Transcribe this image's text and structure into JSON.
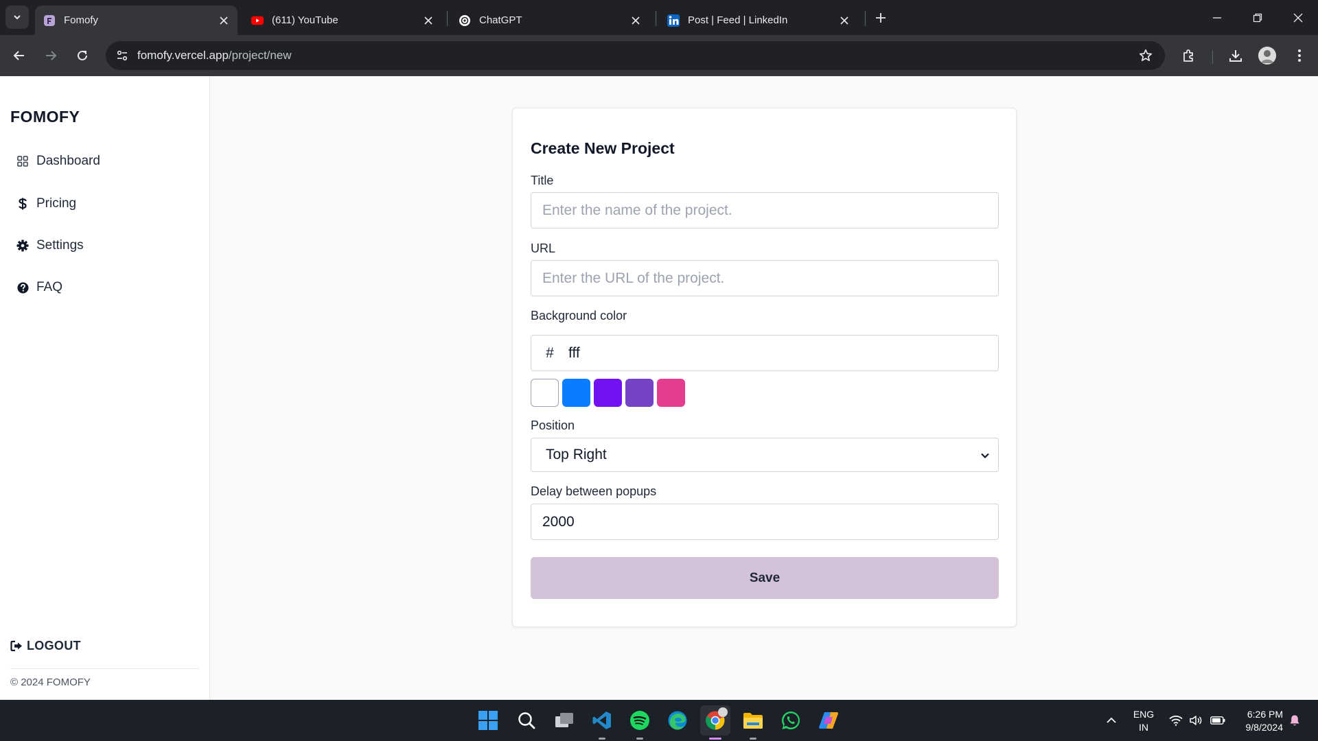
{
  "browser": {
    "tabs": [
      {
        "title": "Fomofy",
        "active": true
      },
      {
        "title": "(611) YouTube",
        "active": false
      },
      {
        "title": "ChatGPT",
        "active": false
      },
      {
        "title": "Post | Feed | LinkedIn",
        "active": false
      }
    ],
    "url_host": "fomofy.vercel.app",
    "url_path": "/project/new"
  },
  "sidebar": {
    "logo": "FOMOFY",
    "items": [
      {
        "label": "Dashboard",
        "icon": "grid-icon"
      },
      {
        "label": "Pricing",
        "icon": "dollar-icon"
      },
      {
        "label": "Settings",
        "icon": "gear-icon"
      },
      {
        "label": "FAQ",
        "icon": "question-circle-icon"
      }
    ],
    "logout": "LOGOUT",
    "copyright": "© 2024 FOMOFY"
  },
  "form": {
    "heading": "Create New Project",
    "title_label": "Title",
    "title_placeholder": "Enter the name of the project.",
    "url_label": "URL",
    "url_placeholder": "Enter the URL of the project.",
    "bg_label": "Background color",
    "hash": "#",
    "bg_value": "fff",
    "swatches": [
      "#ffffff",
      "#0a7cff",
      "#7312f0",
      "#7443c6",
      "#e63e8f"
    ],
    "position_label": "Position",
    "position_value": "Top Right",
    "delay_label": "Delay between popups",
    "delay_value": "2000",
    "save_label": "Save"
  },
  "taskbar": {
    "lang_line1": "ENG",
    "lang_line2": "IN",
    "time": "6:26 PM",
    "date": "9/8/2024"
  }
}
